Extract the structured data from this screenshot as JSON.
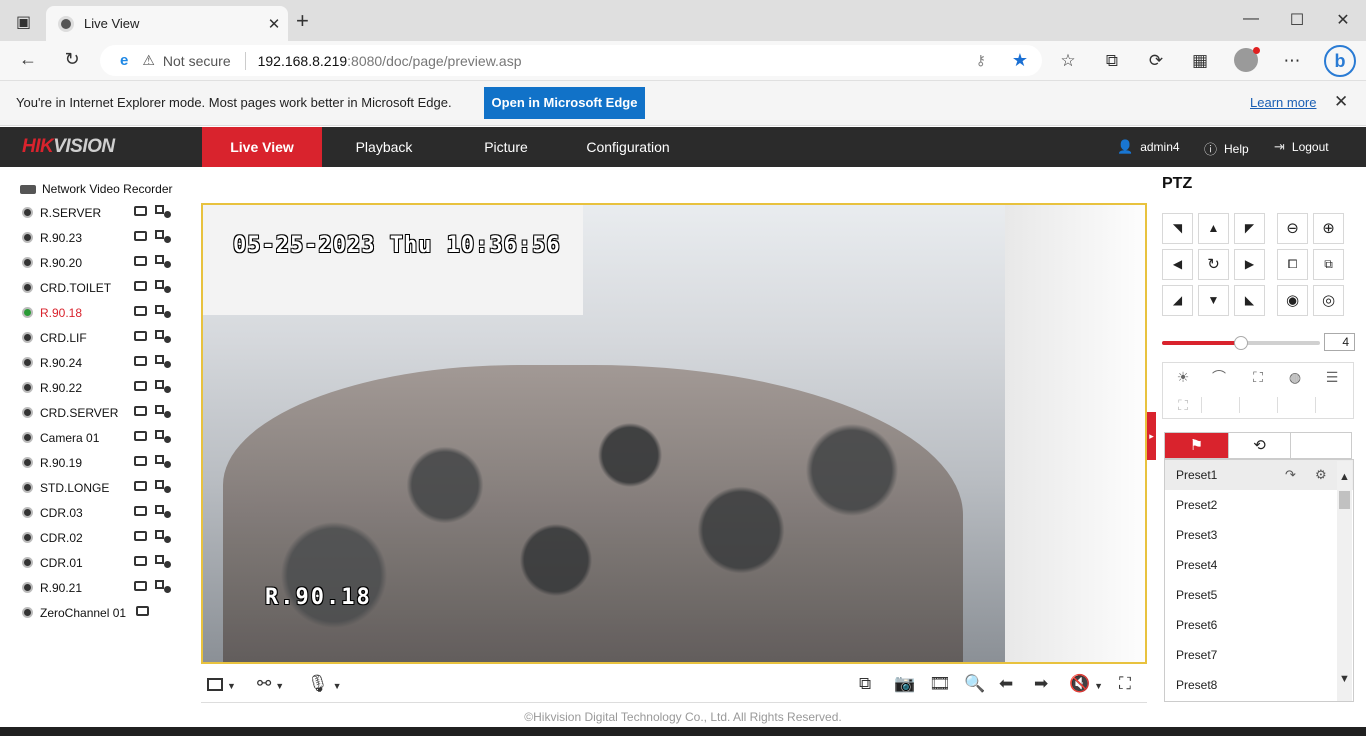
{
  "browser": {
    "tab_title": "Live View",
    "tab_close": "✕",
    "new_tab": "+",
    "address": {
      "security_label": "Not secure",
      "host": "192.168.8.219",
      "path": ":8080/doc/page/preview.asp"
    },
    "ie_bar": {
      "message": "You're in Internet Explorer mode. Most pages work better in Microsoft Edge.",
      "open_button": "Open in Microsoft Edge",
      "learn_more": "Learn more"
    }
  },
  "app": {
    "logo_red": "HIK",
    "logo_gray": "VISION",
    "menu": [
      {
        "label": "Live View",
        "active": true
      },
      {
        "label": "Playback",
        "active": false
      },
      {
        "label": "Picture",
        "active": false
      },
      {
        "label": "Configuration",
        "active": false
      }
    ],
    "user": "admin4",
    "help": "Help",
    "logout": "Logout"
  },
  "tree": {
    "root": "Network Video Recorder",
    "cameras": [
      "R.SERVER",
      "R.90.23",
      "R.90.20",
      "CRD.TOILET",
      "R.90.18",
      "CRD.LIF",
      "R.90.24",
      "R.90.22",
      "CRD.SERVER",
      "Camera 01",
      "R.90.19",
      "STD.LONGE",
      "CDR.03",
      "CDR.02",
      "CDR.01",
      "R.90.21",
      "ZeroChannel 01"
    ],
    "active_index": 4
  },
  "video": {
    "osd_datetime": "05-25-2023 Thu 10:36:56",
    "osd_channel": "R.90.18"
  },
  "ptz": {
    "title": "PTZ",
    "speed_value": "4",
    "speed_fraction": 0.5,
    "presets": [
      "Preset1",
      "Preset2",
      "Preset3",
      "Preset4",
      "Preset5",
      "Preset6",
      "Preset7",
      "Preset8"
    ]
  },
  "footer": "©Hikvision Digital Technology Co., Ltd. All Rights Reserved.",
  "colors": {
    "brand_red": "#d9232d",
    "header_dark": "#2b2b2b",
    "edge_blue": "#1172c8",
    "video_border": "#e8c23e"
  }
}
